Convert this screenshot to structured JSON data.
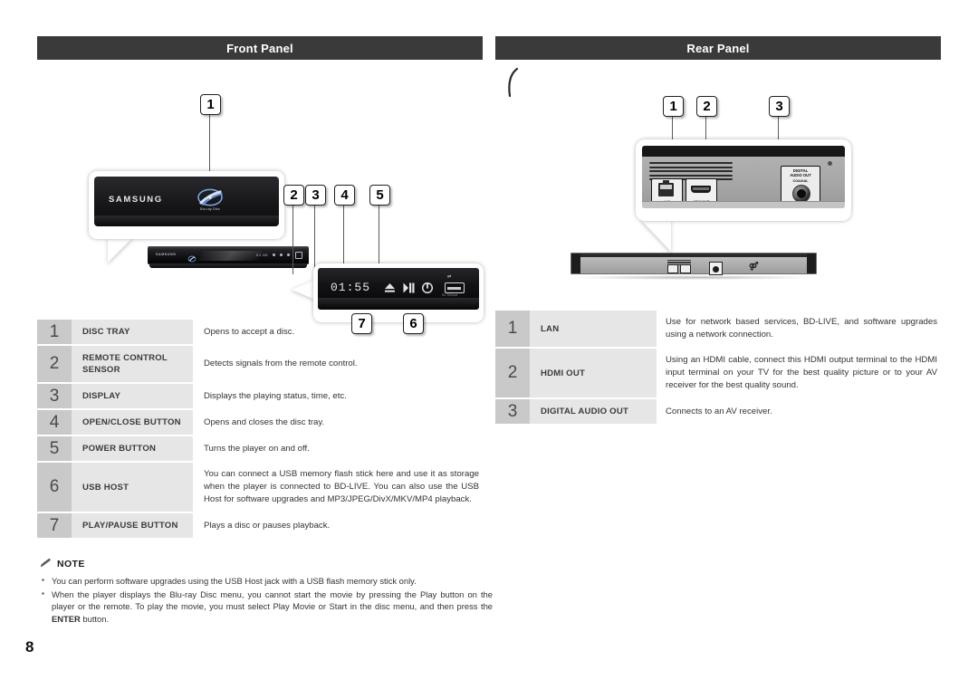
{
  "page": {
    "number": "8"
  },
  "left": {
    "section_title": "Front Panel",
    "illustration": {
      "brand_logo": "SAMSUNG",
      "bd_logo_text": "Blu-ray Disc",
      "display_value": "01:55",
      "usb_label": "USB",
      "usb_sub": "5V 500mA",
      "icons": {
        "eject": "eject-icon",
        "play_pause": "play-pause-icon",
        "power": "power-icon",
        "usb": "usb-icon"
      },
      "callouts": [
        "1",
        "2",
        "3",
        "4",
        "5",
        "6",
        "7"
      ]
    },
    "table": {
      "rows": [
        {
          "num": "1",
          "label": "DISC TRAY",
          "desc": "Opens to accept a disc."
        },
        {
          "num": "2",
          "label": "REMOTE CONTROL SENSOR",
          "desc": "Detects signals from the remote control."
        },
        {
          "num": "3",
          "label": "DISPLAY",
          "desc": "Displays the playing status, time, etc."
        },
        {
          "num": "4",
          "label": "OPEN/CLOSE BUTTON",
          "desc": "Opens and closes the disc tray."
        },
        {
          "num": "5",
          "label": "POWER BUTTON",
          "desc": "Turns the player on and off."
        },
        {
          "num": "6",
          "label": "USB HOST",
          "desc": "You can connect a USB memory flash stick here and use it as storage when the player is connected to BD-LIVE. You can also use the USB Host for software upgrades and MP3/JPEG/DivX/MKV/MP4 playback."
        },
        {
          "num": "7",
          "label": "PLAY/PAUSE BUTTON",
          "desc": "Plays a disc or pauses playback."
        }
      ]
    }
  },
  "right": {
    "section_title": "Rear Panel",
    "illustration": {
      "port_labels": {
        "lan": "LAN",
        "hdmi": "HDMI OUT",
        "coax_title_1": "DIGITAL",
        "coax_title_2": "AUDIO OUT",
        "coax_title_3": "COAXIAL"
      },
      "callouts": [
        "1",
        "2",
        "3"
      ]
    },
    "table": {
      "rows": [
        {
          "num": "1",
          "label": "LAN",
          "desc": "Use for network based services, BD-LIVE, and software upgrades using a network connection."
        },
        {
          "num": "2",
          "label": "HDMI OUT",
          "desc": "Using an HDMI cable, connect this HDMI output terminal to the HDMI input terminal on your TV for the best quality picture or to your AV receiver for the best quality sound."
        },
        {
          "num": "3",
          "label": "DIGITAL AUDIO OUT",
          "desc": "Connects to an AV receiver."
        }
      ]
    }
  },
  "note": {
    "icon": "pencil-icon",
    "title": "NOTE",
    "items": [
      {
        "text_1": "You can perform software upgrades using the USB Host jack with a USB flash memory stick only.",
        "bold": "",
        "text_2": ""
      },
      {
        "text_1": "When the player displays the Blu-ray Disc menu, you cannot start the movie by pressing the Play button on the player or the remote. To play the movie, you must select Play Movie or Start in the disc menu, and then press the ",
        "bold": "ENTER",
        "text_2": " button."
      }
    ]
  },
  "colors": {
    "header_bar": "#3a3a3a",
    "num_cell": "#c9c9c9",
    "label_cell": "#e6e6e6",
    "text": "#333333"
  }
}
